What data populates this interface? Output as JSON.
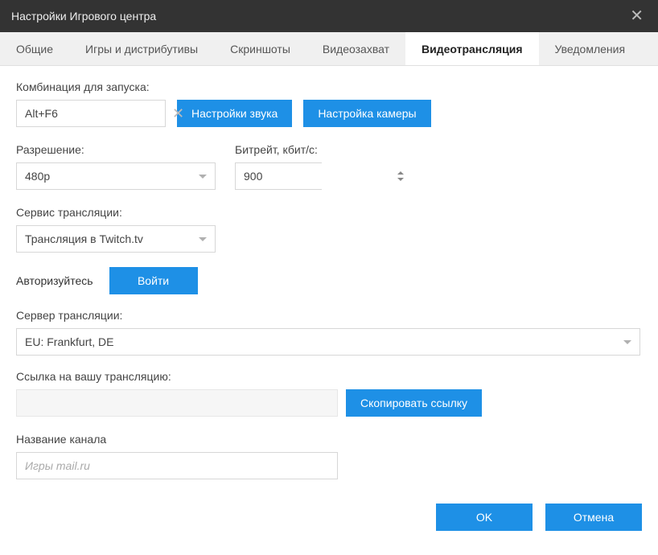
{
  "window": {
    "title": "Настройки Игрового центра"
  },
  "tabs": {
    "general": "Общие",
    "games": "Игры и дистрибутивы",
    "screenshots": "Скриншоты",
    "capture": "Видеозахват",
    "streaming": "Видеотрансляция",
    "notifications": "Уведомления"
  },
  "form": {
    "hotkey_label": "Комбинация для запуска:",
    "hotkey_value": "Alt+F6",
    "sound_settings_btn": "Настройки звука",
    "camera_settings_btn": "Настройка камеры",
    "resolution_label": "Разрешение:",
    "resolution_value": "480p",
    "bitrate_label": "Битрейт, кбит/с:",
    "bitrate_value": "900",
    "service_label": "Сервис трансляции:",
    "service_value": "Трансляция в Twitch.tv",
    "auth_label": "Авторизуйтесь",
    "login_btn": "Войти",
    "server_label": "Сервер трансляции:",
    "server_value": "EU: Frankfurt, DE",
    "link_label": "Ссылка на вашу трансляцию:",
    "copy_link_btn": "Скопировать ссылку",
    "channel_label": "Название канала",
    "channel_placeholder": "Игры mail.ru"
  },
  "footer": {
    "ok": "OK",
    "cancel": "Отмена"
  }
}
